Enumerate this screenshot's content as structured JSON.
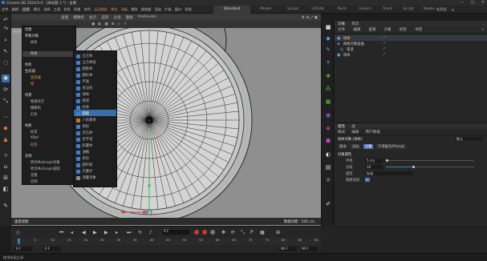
{
  "app": {
    "title": "Cinema 4D 2024.0.0 - [未标题 1 *] - 主要",
    "window_controls": [
      "—",
      "□",
      "✕"
    ]
  },
  "menubar": {
    "items": [
      "文件",
      "编辑",
      "创建",
      "模式",
      "选择",
      "工具",
      "样条",
      "网格",
      "体积",
      "运动图形",
      "角色",
      "动画",
      "模拟",
      "跟踪器",
      "渲染",
      "扩展",
      "窗口",
      "帮助"
    ],
    "accent_items": [
      "运动图形",
      "角色",
      "动画"
    ],
    "layout_tabs": [
      "Standard",
      "Model",
      "Sculpt",
      "UVEdit",
      "Paint",
      "Groom",
      "Track",
      "Script",
      "Nodes"
    ],
    "active_layout": "Standard",
    "right": [
      "新界面"
    ]
  },
  "viewport": {
    "menu": [
      "查看",
      "摄像机",
      "显示",
      "选项",
      "过滤",
      "面板",
      "ProRender"
    ],
    "camera_label": "透视视图",
    "status_left": "垂直视图",
    "status_right": "网格间距 : 100 cm"
  },
  "create_menu": {
    "items": [
      {
        "label": "创建",
        "kind": "head"
      },
      {
        "label": "参数对象",
        "kind": "head"
      },
      {
        "label": "样条",
        "kind": "item"
      },
      {
        "label": "网格",
        "kind": "item"
      },
      {
        "label": "体积",
        "kind": "head"
      },
      {
        "label": "生成器",
        "kind": "head"
      },
      {
        "label": "变形器",
        "kind": "orange"
      },
      {
        "label": "域",
        "kind": "orange"
      },
      {
        "label": "场景",
        "kind": "head"
      },
      {
        "label": "物理天空",
        "kind": "item"
      },
      {
        "label": "摄像机",
        "kind": "item"
      },
      {
        "label": "灯光",
        "kind": "item"
      },
      {
        "label": "材质",
        "kind": "head"
      },
      {
        "label": "标签",
        "kind": "item"
      },
      {
        "label": "XRef",
        "kind": "item"
      },
      {
        "label": "标签",
        "kind": "orange"
      },
      {
        "label": "其他",
        "kind": "head"
      },
      {
        "label": "转为MoGraph对象",
        "kind": "item"
      },
      {
        "label": "转为MoGraph追踪",
        "kind": "item"
      },
      {
        "label": "克隆",
        "kind": "item"
      },
      {
        "label": "实例",
        "kind": "item"
      }
    ],
    "highlighted": "网格"
  },
  "sub_menu": {
    "items": [
      "立方体",
      "立方体组",
      "圆锥体",
      "圆柱体",
      "平面",
      "多边形",
      "球体",
      "管道",
      "柱体",
      "圆盘",
      "人形素体",
      "地形",
      "宝石体",
      "金字塔",
      "胶囊体",
      "油桶",
      "条形",
      "圆环面",
      "贝塞尔",
      "测量对象"
    ],
    "highlighted": "圆盘"
  },
  "object_manager": {
    "tabs": [
      "对象",
      "场次"
    ],
    "menu": [
      "文件",
      "编辑",
      "查看",
      "对象",
      "标签",
      "书签"
    ],
    "objects": [
      {
        "name": "球体",
        "selected": true
      },
      {
        "name": "网格对象扭曲",
        "selected": false
      },
      {
        "name": "管道",
        "selected": false
      },
      {
        "name": "球体",
        "selected": false
      }
    ]
  },
  "attribute_manager": {
    "tabs": [
      "属性",
      "层"
    ],
    "menu": [
      "模式",
      "编辑",
      "用户数据"
    ],
    "object_label": "球体对象 [球体]",
    "mode_value": "默认",
    "subtabs": [
      "基本",
      "坐标",
      "对象",
      "平滑着色(Phong)"
    ],
    "active_subtab": "对象",
    "section_title": "对象属性",
    "fields": [
      {
        "label": "半径",
        "value": "5 cm"
      },
      {
        "label": "分段",
        "value": "32"
      },
      {
        "label": "类型",
        "value": "标准"
      },
      {
        "label": "理想渲染",
        "value": "✓"
      }
    ]
  },
  "timeline": {
    "current_frame": "0 F",
    "ruler_ticks": [
      "0",
      "5",
      "10",
      "15",
      "20",
      "25",
      "30",
      "35",
      "40",
      "45",
      "50",
      "55",
      "60",
      "65",
      "70",
      "75",
      "80",
      "85",
      "90"
    ],
    "start_field": "0 F",
    "end_field": "0 F",
    "min_field": "90 F",
    "max_field": "90 F"
  },
  "statusbar": {
    "text": "使用绘画工具"
  },
  "colors": {
    "accent_blue": "#3b6ea8",
    "check_green": "#56c22a",
    "record_red": "#c43a36",
    "menu_orange": "#d99a3a"
  }
}
